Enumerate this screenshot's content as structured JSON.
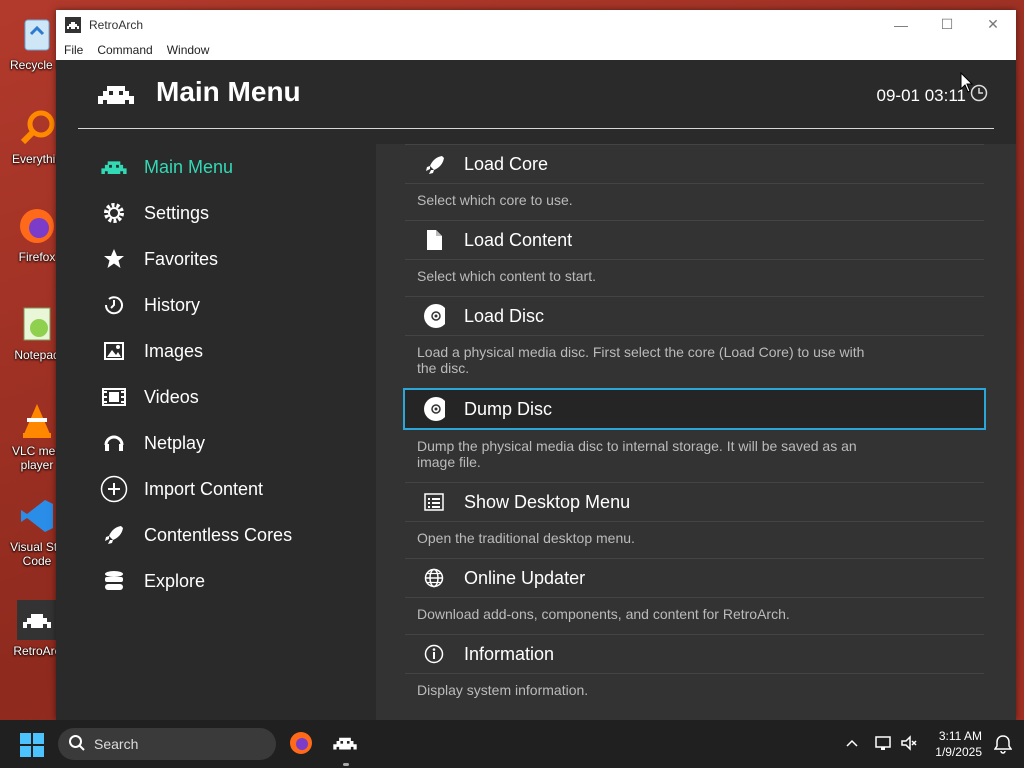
{
  "desktop": {
    "icons": [
      {
        "label": "Recycle B",
        "icon": "recycle-bin-icon"
      },
      {
        "label": "Everythin",
        "icon": "everything-search-icon"
      },
      {
        "label": "Firefox",
        "icon": "firefox-icon"
      },
      {
        "label": "Notepad",
        "icon": "notepad-icon"
      },
      {
        "label": "VLC med\nplayer",
        "icon": "vlc-icon"
      },
      {
        "label": "Visual Stu\nCode",
        "icon": "vscode-icon"
      },
      {
        "label": "RetroArc",
        "icon": "retroarch-icon"
      }
    ]
  },
  "window": {
    "title": "RetroArch",
    "menus": [
      "File",
      "Command",
      "Window"
    ],
    "controls": {
      "minimize": "—",
      "maximize": "☐",
      "close": "✕"
    }
  },
  "header": {
    "title": "Main Menu",
    "clock": "09-01 03:11"
  },
  "sidebar": {
    "items": [
      {
        "label": "Main Menu",
        "icon": "invader-icon",
        "active": true
      },
      {
        "label": "Settings",
        "icon": "gear-icon"
      },
      {
        "label": "Favorites",
        "icon": "star-icon"
      },
      {
        "label": "History",
        "icon": "history-icon"
      },
      {
        "label": "Images",
        "icon": "image-icon"
      },
      {
        "label": "Videos",
        "icon": "film-icon"
      },
      {
        "label": "Netplay",
        "icon": "headset-icon"
      },
      {
        "label": "Import Content",
        "icon": "plus-circle-icon"
      },
      {
        "label": "Contentless Cores",
        "icon": "rocket-icon"
      },
      {
        "label": "Explore",
        "icon": "database-icon"
      }
    ]
  },
  "entries": [
    {
      "label": "Load Core",
      "desc": "Select which core to use.",
      "icon": "rocket-icon"
    },
    {
      "label": "Load Content",
      "desc": "Select which content to start.",
      "icon": "file-icon"
    },
    {
      "label": "Load Disc",
      "desc": "Load a physical media disc. First select the core (Load Core) to use with the disc.",
      "icon": "disc-icon"
    },
    {
      "label": "Dump Disc",
      "desc": "Dump the physical media disc to internal storage. It will be saved as an image file.",
      "icon": "disc-icon",
      "selected": true
    },
    {
      "label": "Show Desktop Menu",
      "desc": "Open the traditional desktop menu.",
      "icon": "list-icon"
    },
    {
      "label": "Online Updater",
      "desc": "Download add-ons, components, and content for RetroArch.",
      "icon": "globe-icon"
    },
    {
      "label": "Information",
      "desc": "Display system information.",
      "icon": "info-icon"
    }
  ],
  "taskbar": {
    "search_placeholder": "Search",
    "time": "3:11 AM",
    "date": "1/9/2025"
  },
  "colors": {
    "accent": "#32d9b5",
    "selection_border": "#2aa7d8"
  }
}
